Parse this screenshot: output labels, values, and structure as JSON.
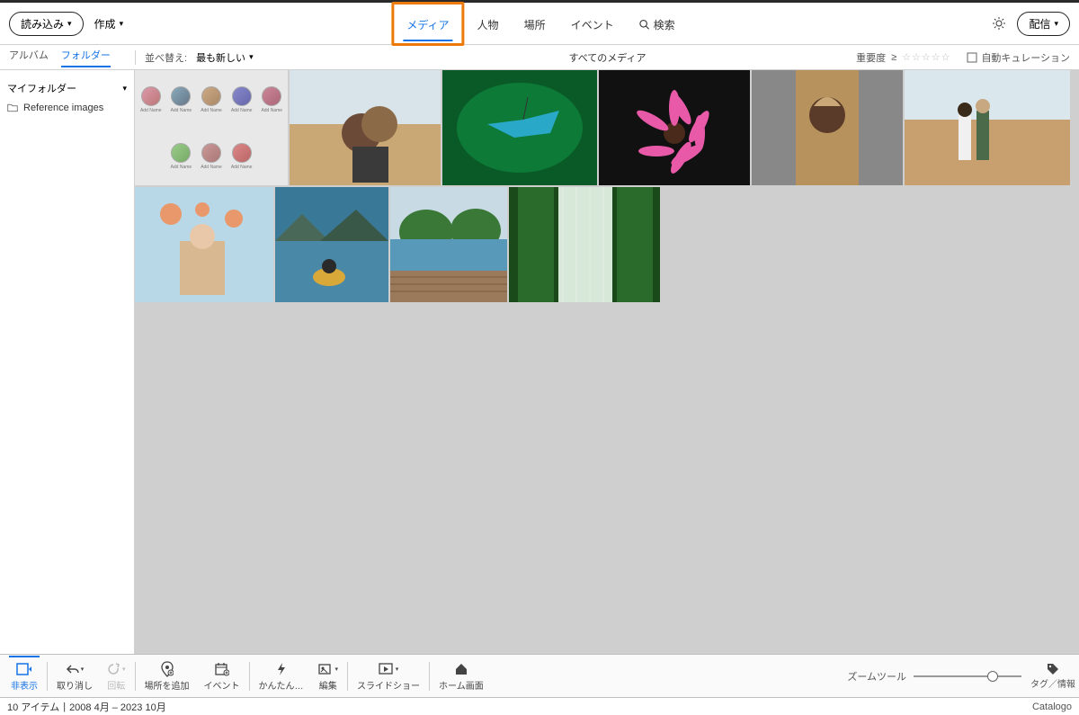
{
  "topbar": {
    "import_label": "読み込み",
    "create_label": "作成",
    "tabs": [
      {
        "label": "メディア",
        "active": true,
        "highlight": true
      },
      {
        "label": "人物"
      },
      {
        "label": "場所"
      },
      {
        "label": "イベント"
      }
    ],
    "search_label": "検索",
    "share_label": "配信"
  },
  "subbar": {
    "side_tabs": [
      {
        "label": "アルバム"
      },
      {
        "label": "フォルダー",
        "active": true
      }
    ],
    "sort_label": "並べ替え:",
    "sort_value": "最も新しい",
    "center_label": "すべてのメディア",
    "importance_label": "重要度",
    "importance_op": "≥",
    "auto_curation": "自動キュレーション"
  },
  "sidebar": {
    "my_folder": "マイフォルダー",
    "items": [
      {
        "label": "Reference images"
      }
    ]
  },
  "thumbs": {
    "avatar_caption": "Add Name"
  },
  "bottombar": {
    "hide": "非表示",
    "undo": "取り消し",
    "rotate": "回転",
    "add_place": "場所を追加",
    "event": "イベント",
    "instant": "かんたん…",
    "edit": "編集",
    "slideshow": "スライドショー",
    "home": "ホーム画面",
    "zoom_tool": "ズームツール",
    "tag_info": "タグ／情報"
  },
  "statusbar": {
    "count_text": "10 アイテム",
    "range_text": "2008 4月 – 2023 10月",
    "catalog": "Catalogo"
  }
}
